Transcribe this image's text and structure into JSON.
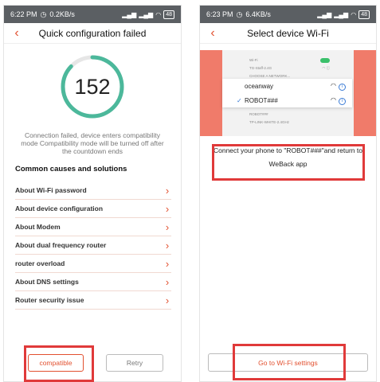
{
  "left": {
    "status": {
      "time": "6:22 PM",
      "speed": "0.2KB/s",
      "battery": "48"
    },
    "title": "Quick configuration failed",
    "countdown": "152",
    "countdown_progress": 0.87,
    "message": "Connection failed, device enters compatibility mode Compatibility mode will be turned off after the countdown ends",
    "section_title": "Common causes and solutions",
    "items": [
      {
        "label": "About Wi-Fi password"
      },
      {
        "label": "About device configuration"
      },
      {
        "label": "About Modem"
      },
      {
        "label": "About dual frequency router"
      },
      {
        "label": "router overload"
      },
      {
        "label": "About DNS settings"
      },
      {
        "label": "Router security issue"
      }
    ],
    "compatible_label": "compatible",
    "retry_label": "Retry"
  },
  "right": {
    "status": {
      "time": "6:23 PM",
      "speed": "6.4KB/s",
      "battery": "48"
    },
    "title": "Select device Wi-Fi",
    "illustration": {
      "wifi_label": "Wi-Fi",
      "network_top": "TG-Staff-2.4G",
      "choose_label": "CHOOSE A NETWORK...",
      "network_1": "oceanway",
      "network_2": "ROBOT###",
      "faded_1": "ROBOT###",
      "faded_2": "TP-LINK-WHITE-2.4GHz"
    },
    "instruction": "Connect your phone to \"ROBOT###\"and return to WeBack app",
    "button_label": "Go to Wi-Fi settings"
  },
  "colors": {
    "accent": "#e2502f",
    "highlight": "#e03a3a",
    "ring": "#4cb89b"
  }
}
